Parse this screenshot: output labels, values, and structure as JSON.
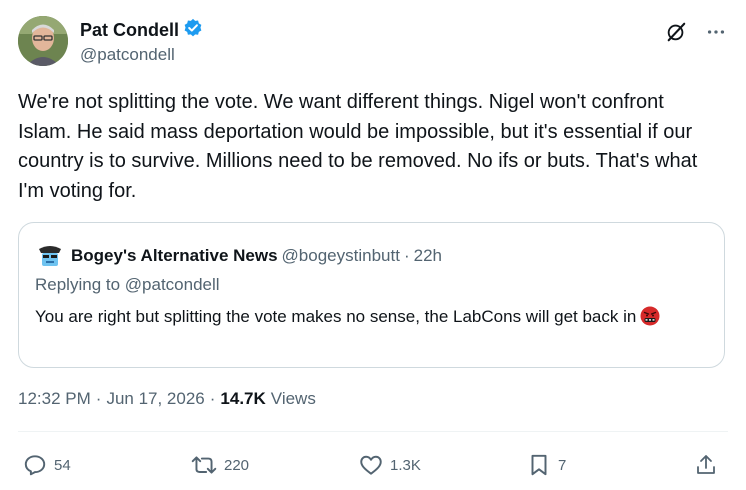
{
  "author": {
    "display_name": "Pat Condell",
    "handle": "@patcondell",
    "verified": true
  },
  "post": {
    "text": "We're not splitting the vote. We want different things. Nigel won't confront Islam. He said mass deportation would be impossible, but it's essential if our country is to survive. Millions need to be removed. No ifs or buts. That's what I'm voting for."
  },
  "quote": {
    "display_name": "Bogey's Alternative News",
    "handle": "@bogeystinbutt",
    "separator": "·",
    "time": "22h",
    "replying_prefix": "Replying to",
    "replying_handle": "@patcondell",
    "text": "You are right but splitting the vote makes no sense, the LabCons will get back in",
    "emoji_icon": "angry-cursing-face-icon"
  },
  "meta": {
    "time": "12:32 PM",
    "dot": "·",
    "date": "Jun 17, 2026",
    "views_count": "14.7K",
    "views_label": "Views"
  },
  "actions": {
    "replies": "54",
    "reposts": "220",
    "likes": "1.3K",
    "bookmarks": "7"
  },
  "colors": {
    "verified_badge": "#1d9bf0",
    "muted_text": "#536471",
    "primary_text": "#0f1419",
    "border": "#cfd9de"
  }
}
